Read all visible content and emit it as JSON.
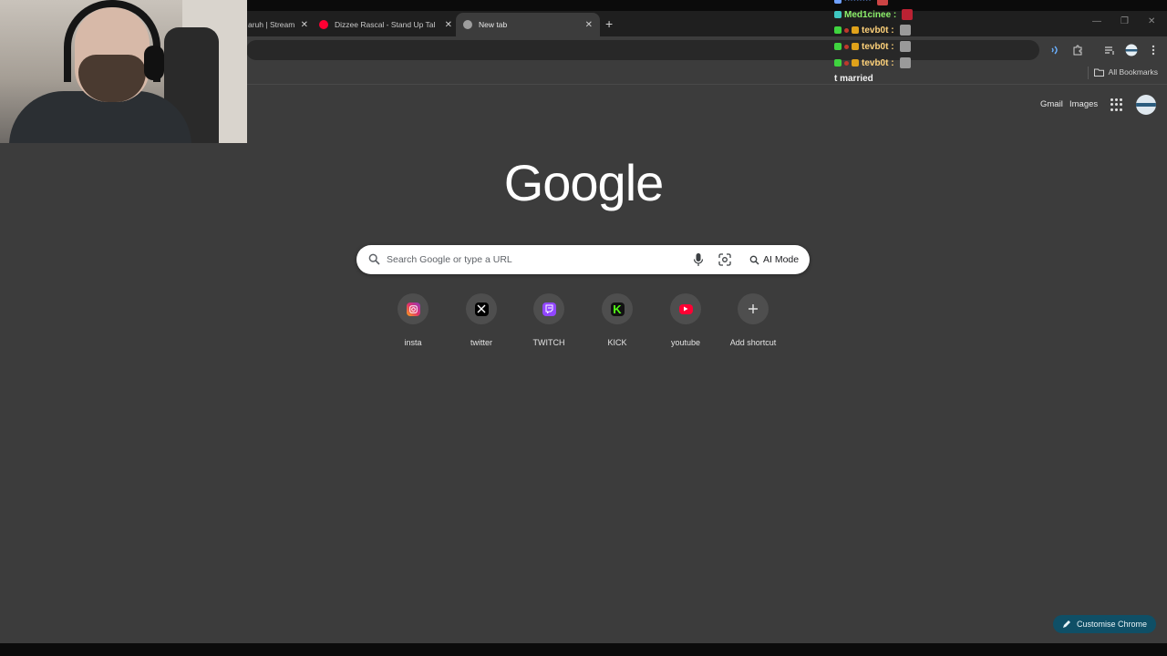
{
  "browser": {
    "tabs": [
      {
        "title": "aruh | Stream",
        "favicon_color": "#e5e5e5"
      },
      {
        "title": "Dizzee Rascal - Stand Up Tall - Y",
        "favicon_color": "#ff0033"
      },
      {
        "title": "New tab",
        "favicon_color": "#bdbdbd"
      }
    ],
    "new_tab_symbol": "+",
    "close_symbol": "✕",
    "window_controls": [
      "—",
      "❐",
      "✕"
    ],
    "bookmarks": {
      "all_label": "All Bookmarks"
    }
  },
  "chat": {
    "lines": [
      {
        "user": "Med1cinee :",
        "color": "#8cf06a"
      },
      {
        "user": "tevb0t :",
        "color": "#ffd27a"
      },
      {
        "user": "tevb0t :",
        "color": "#ffd27a"
      },
      {
        "user": "tevb0t :",
        "color": "#ffd27a"
      }
    ],
    "message": "t married"
  },
  "ntp": {
    "top_links": {
      "gmail": "Gmail",
      "images": "Images"
    },
    "logo": "Google",
    "search": {
      "placeholder": "Search Google or type a URL",
      "ai_mode": "AI Mode"
    },
    "shortcuts": [
      {
        "label": "insta",
        "icon": "instagram-icon",
        "color": "#e1306c"
      },
      {
        "label": "twitter",
        "icon": "x-icon",
        "color": "#000000"
      },
      {
        "label": "TWITCH",
        "icon": "twitch-icon",
        "color": "#9146ff"
      },
      {
        "label": "KICK",
        "icon": "kick-icon",
        "color": "#53fc18"
      },
      {
        "label": "youtube",
        "icon": "youtube-icon",
        "color": "#ff0033"
      },
      {
        "label": "Add shortcut",
        "icon": "plus-icon",
        "color": "#e3e3e3"
      }
    ],
    "customise": "Customise Chrome"
  }
}
